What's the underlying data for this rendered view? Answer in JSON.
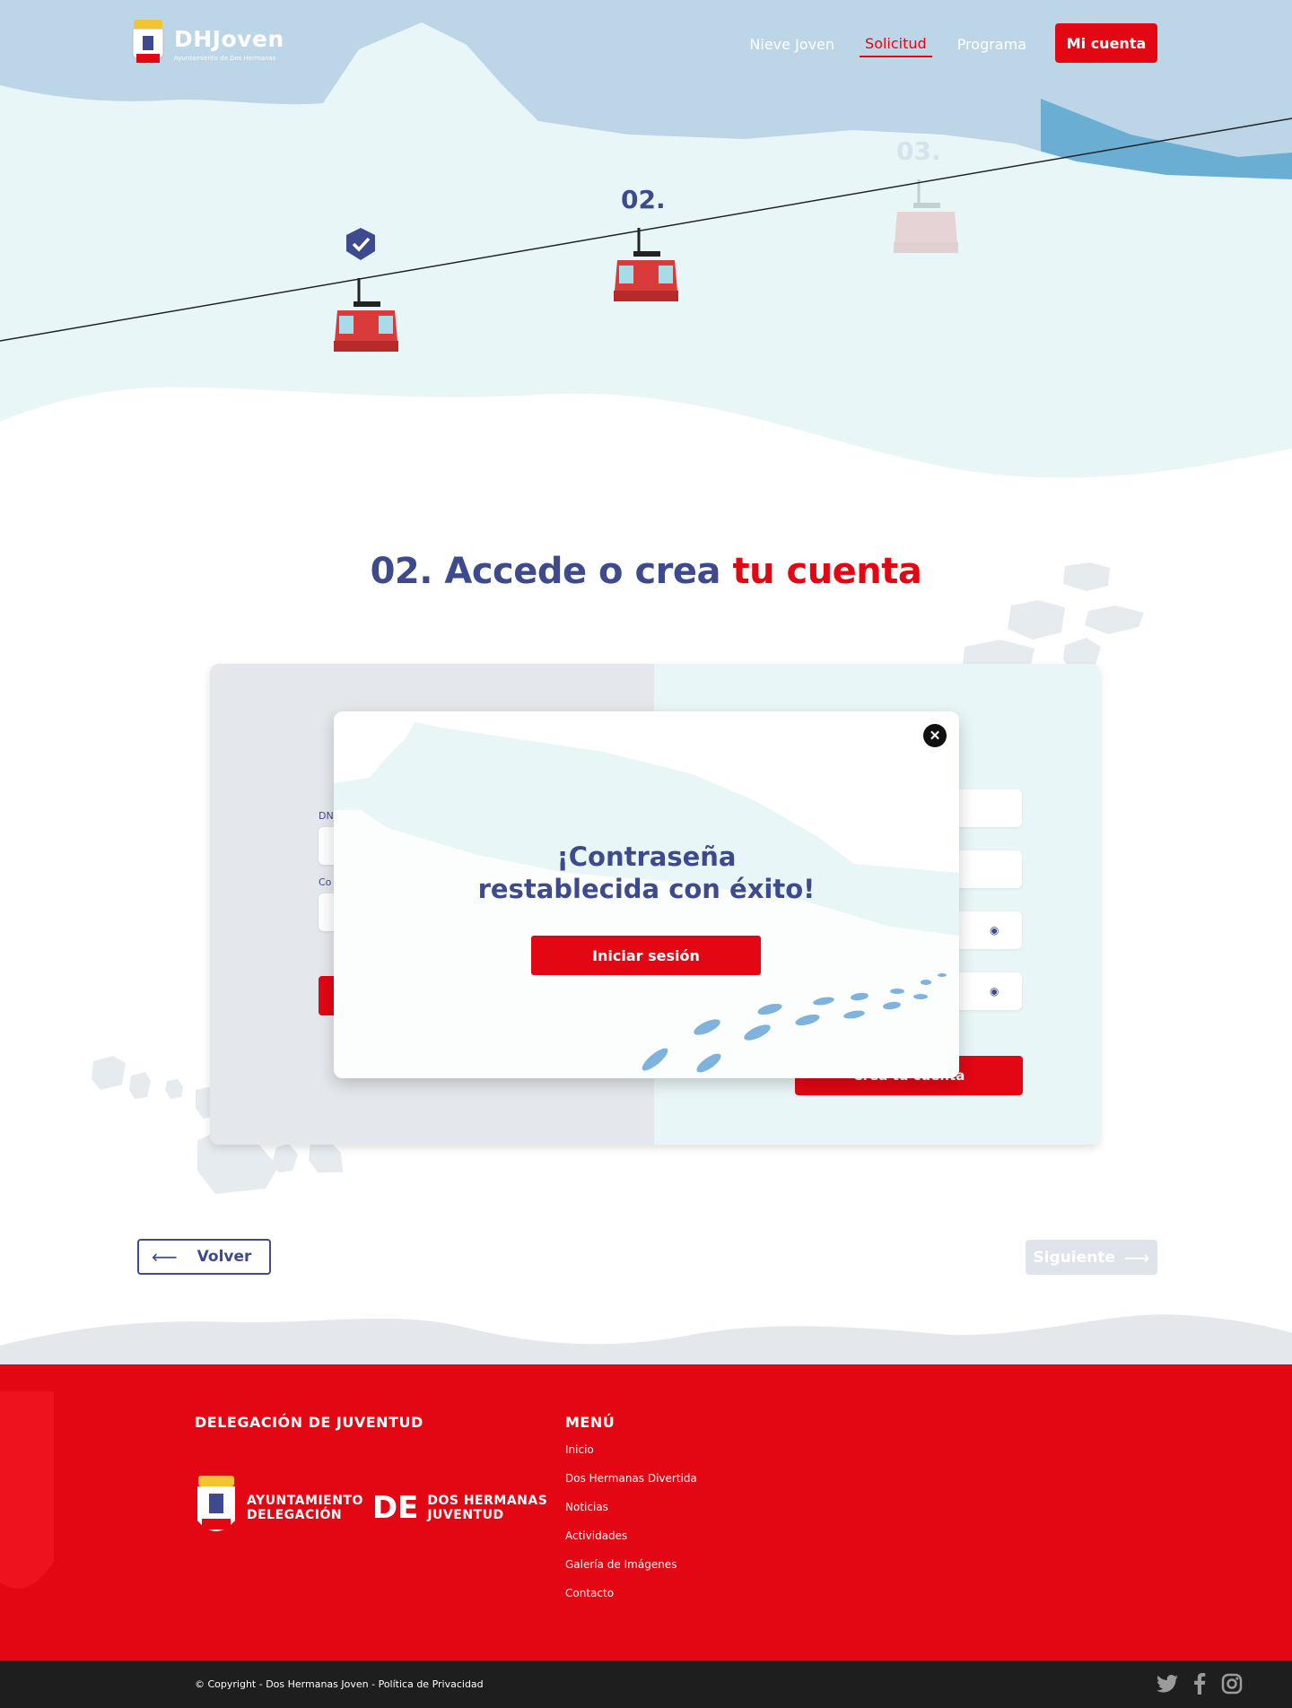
{
  "header": {
    "logo_title": "DHJoven",
    "logo_subtitle": "Ayuntamiento de Dos Hermanas",
    "nav": [
      "Nieve Joven",
      "Solicitud",
      "Programa"
    ],
    "active_nav": "Solicitud",
    "account_button": "Mi cuenta"
  },
  "steps": {
    "current": "02.",
    "next": "03.",
    "completed_count": 1
  },
  "section": {
    "title_part1": "02. Accede o crea",
    "title_part2": "tu cuenta"
  },
  "form_left": {
    "label_dni": "DN",
    "label_pass": "Co"
  },
  "form_right": {
    "create_button": "Crea tu cuenta"
  },
  "modal": {
    "title_line1": "¡Contraseña",
    "title_line2": "restablecida con éxito!",
    "login_button": "Iniciar sesión",
    "close_label": "✕"
  },
  "navigation": {
    "back": "Volver",
    "next": "Siguiente"
  },
  "footer": {
    "delegation_heading": "DELEGACIÓN DE JUVENTUD",
    "menu_heading": "MENÚ",
    "menu_items": [
      "Inicio",
      "Dos Hermanas Divertida",
      "Noticias",
      "Actividades",
      "Galería de Imágenes",
      "Contacto"
    ],
    "logo_line1": "AYUNTAMIENTO",
    "logo_line2": "DELEGACIÓN",
    "logo_de": "DE",
    "logo_line3": "DOS HERMANAS",
    "logo_line4": "JUVENTUD",
    "copyright": "© Copyright - Dos Hermanas Joven - Política de Privacidad",
    "social": [
      "twitter-icon",
      "facebook-icon",
      "instagram-icon"
    ]
  },
  "colors": {
    "brand_red": "#e30613",
    "brand_blue": "#3d4a8e",
    "sky": "#bcd6e8",
    "snow": "#e9f6f8"
  }
}
